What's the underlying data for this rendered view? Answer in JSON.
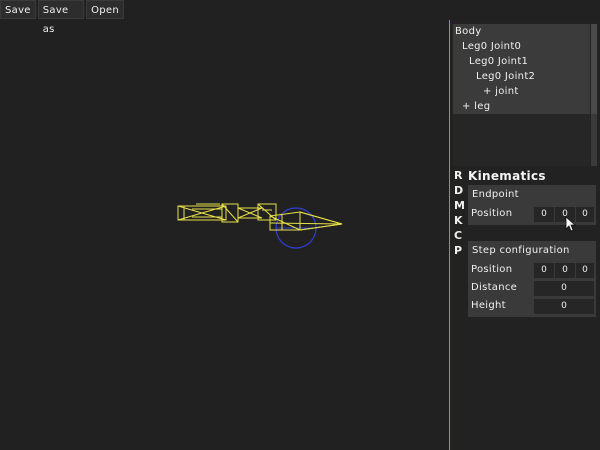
{
  "toolbar": {
    "save": "Save",
    "save_as": "Save as",
    "open": "Open"
  },
  "tree": {
    "items": [
      {
        "label": "Body"
      },
      {
        "label": "Leg0 Joint0"
      },
      {
        "label": "Leg0 Joint1"
      },
      {
        "label": "Leg0 Joint2"
      },
      {
        "label": "+ joint"
      },
      {
        "label": "+ leg"
      }
    ]
  },
  "tabs": [
    "R",
    "D",
    "M",
    "K",
    "C",
    "P"
  ],
  "kinematics": {
    "title": "Kinematics",
    "endpoint": {
      "title": "Endpoint",
      "position_label": "Position",
      "position": [
        "0",
        "0",
        "0"
      ]
    },
    "step": {
      "title": "Step configuration",
      "position_label": "Position",
      "position": [
        "0",
        "0",
        "0"
      ],
      "distance_label": "Distance",
      "distance": "0",
      "height_label": "Height",
      "height": "0"
    }
  },
  "colors": {
    "wireframe": "#e8e04a",
    "gizmo": "#2f3fd0",
    "divider": "#c08a2a"
  }
}
